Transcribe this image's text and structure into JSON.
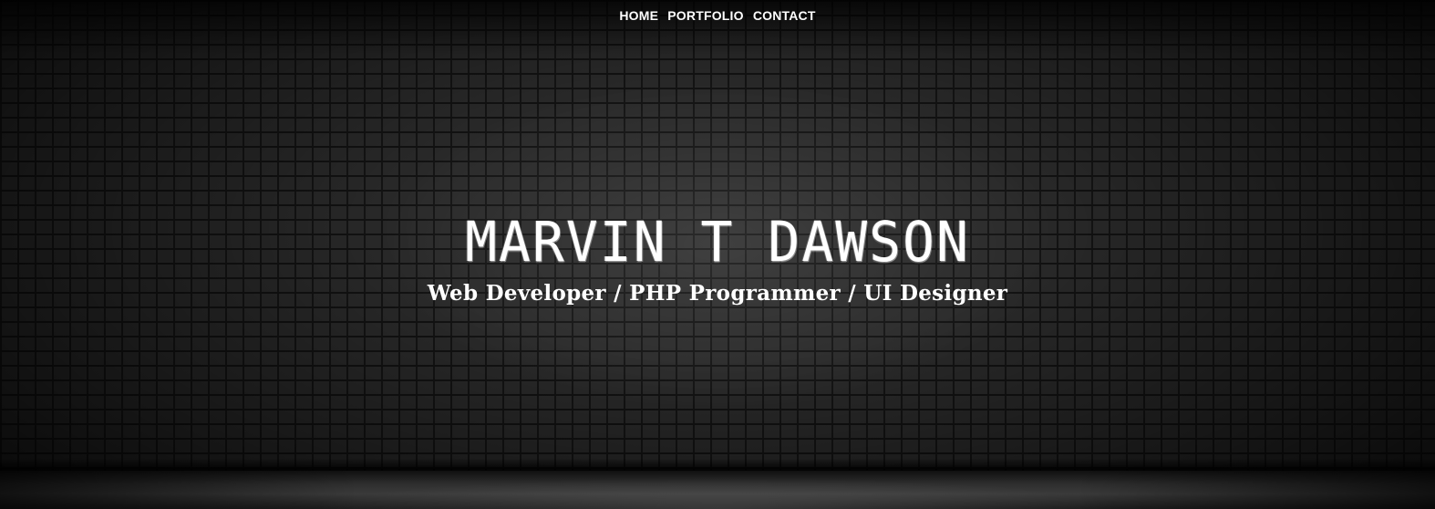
{
  "nav": {
    "items": [
      {
        "label": "HOME"
      },
      {
        "label": "PORTFOLIO"
      },
      {
        "label": "CONTACT"
      }
    ]
  },
  "hero": {
    "name": "MARVIN T DAWSON",
    "tagline": "Web Developer / PHP Programmer / UI Designer"
  },
  "colors": {
    "text": "#ffffff",
    "background": "#2a2a2a"
  }
}
